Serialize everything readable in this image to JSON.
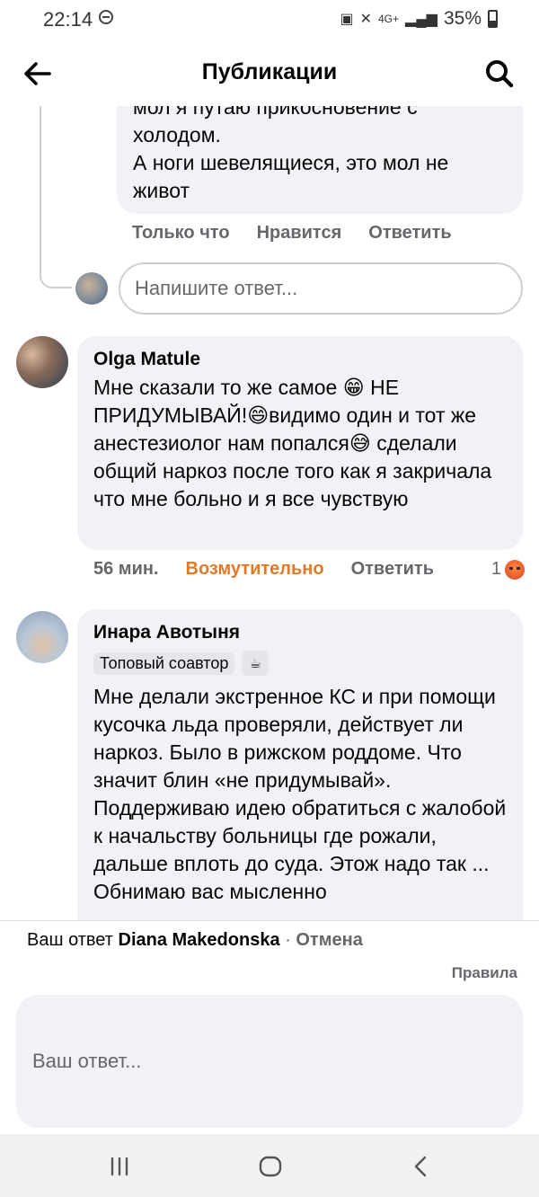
{
  "status_bar": {
    "time": "22:14",
    "network": "4G+",
    "battery": "35%"
  },
  "header": {
    "title": "Публикации"
  },
  "top_comment": {
    "text_partial_line": "мол я путаю прикосновение с",
    "text": "холодом.\nА ноги шевелящиеся, это мол не\nживот",
    "time": "Только что",
    "like": "Нравится",
    "reply": "Ответить"
  },
  "reply_box": {
    "placeholder": "Напишите ответ..."
  },
  "comments": [
    {
      "author": "Olga Matule",
      "text": "Мне сказали то же самое 😁 НЕ ПРИДУМЫВАЙ!😄видимо один и тот же анестезиолог нам попался😅 сделали общий наркоз после того как я закричала что мне больно и я все чувствую",
      "time": "56 мин.",
      "reaction": "Возмутительно",
      "reply": "Ответить",
      "reaction_count": "1"
    },
    {
      "author": "Инара Авотыня",
      "badge": "Топовый соавтор",
      "text": "Мне делали экстренное КС и при помощи кусочка льда проверяли, действует ли наркоз. Было в рижском роддоме. Что значит блин «не придумывай». Поддерживаю идею обратиться с жалобой к начальству больницы где рожали, дальше вплоть до суда. Этож надо так ...",
      "text_partial_line": "Обнимаю вас мысленно"
    }
  ],
  "composer": {
    "replying_prefix": "Ваш ответ",
    "replying_name": "Diana Makedonska",
    "separator": "·",
    "cancel": "Отмена",
    "rules": "Правила",
    "placeholder": "Ваш ответ..."
  },
  "icons": {
    "back": "arrow-left-icon",
    "search": "magnifier-icon",
    "badge_cup": "coffee-cup-icon",
    "reaction": "angry-face-icon"
  }
}
